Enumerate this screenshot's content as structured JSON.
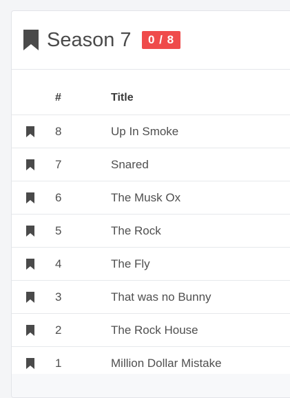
{
  "season": {
    "title": "Season 7",
    "badge": "0 / 8",
    "icon": "bookmark-icon",
    "badge_color": "#ef4b4b"
  },
  "table": {
    "columns": [
      "",
      "#",
      "Title"
    ],
    "rows": [
      {
        "num": "8",
        "title": "Up In Smoke"
      },
      {
        "num": "7",
        "title": "Snared"
      },
      {
        "num": "6",
        "title": "The Musk Ox"
      },
      {
        "num": "5",
        "title": "The Rock"
      },
      {
        "num": "4",
        "title": "The Fly"
      },
      {
        "num": "3",
        "title": "That was no Bunny"
      },
      {
        "num": "2",
        "title": "The Rock House"
      },
      {
        "num": "1",
        "title": "Million Dollar Mistake"
      }
    ]
  }
}
